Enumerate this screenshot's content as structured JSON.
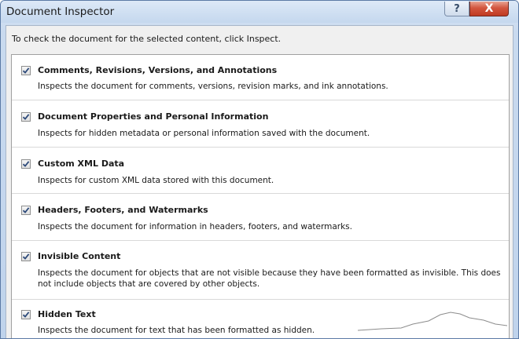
{
  "window": {
    "title": "Document Inspector",
    "help_glyph": "?",
    "close_glyph": "X"
  },
  "instruction": "To check the document for the selected content, click Inspect.",
  "items": [
    {
      "title": "Comments, Revisions, Versions, and Annotations",
      "description": "Inspects the document for comments, versions, revision marks, and ink annotations.",
      "checked": true
    },
    {
      "title": "Document Properties and Personal Information",
      "description": "Inspects for hidden metadata or personal information saved with the document.",
      "checked": true
    },
    {
      "title": "Custom XML Data",
      "description": "Inspects for custom XML data stored with this document.",
      "checked": true
    },
    {
      "title": "Headers, Footers, and Watermarks",
      "description": "Inspects the document for information in headers, footers, and watermarks.",
      "checked": true
    },
    {
      "title": "Invisible Content",
      "description": "Inspects the document for objects that are not visible because they have been formatted as invisible. This does not include objects that are covered by other objects.",
      "checked": true
    },
    {
      "title": "Hidden Text",
      "description": "Inspects the document for text that has been formatted as hidden.",
      "checked": true
    }
  ],
  "colors": {
    "close_button": "#c8452c",
    "checkmark": "#2d4a7a",
    "title_bar": "#cfdff2"
  }
}
